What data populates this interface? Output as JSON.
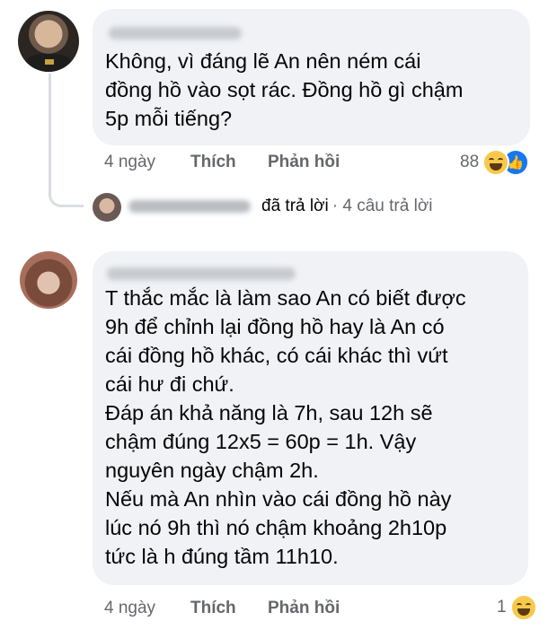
{
  "comments": [
    {
      "text": "Không, vì đáng lẽ An nên ném cái\nđồng hồ vào sọt rác. Đồng hồ gì chậm\n5p mỗi tiếng?",
      "time": "4 ngày",
      "like_label": "Thích",
      "reply_label": "Phản hồi",
      "reaction_count": "88",
      "reaction_icons": [
        "haha-emoji-icon",
        "like-thumb-icon"
      ]
    },
    {
      "text": "T thắc mắc là làm sao An có biết được\n9h để chỉnh lại đồng hồ hay là An có\ncái đồng hồ khác, có cái khác thì vứt\ncái hư đi chứ.\nĐáp án khả năng là 7h, sau 12h sẽ\nchậm đúng 12x5 = 60p = 1h. Vậy\nnguyên ngày chậm 2h.\nNếu mà An nhìn vào cái đồng hồ này\nlúc nó 9h thì nó chậm khoảng 2h10p\ntức là h đúng tầm 11h10.",
      "time": "4 ngày",
      "like_label": "Thích",
      "reply_label": "Phản hồi",
      "reaction_count": "1",
      "reaction_icons": [
        "haha-emoji-icon"
      ]
    }
  ],
  "reply_summary": {
    "action": "đã trả lời",
    "count": "· 4 câu trả lời"
  },
  "colors": {
    "bubble": "#f0f2f5",
    "secondary_text": "#65676b",
    "like_blue": "#1877f2",
    "haha_yellow": "#f7c94b"
  }
}
